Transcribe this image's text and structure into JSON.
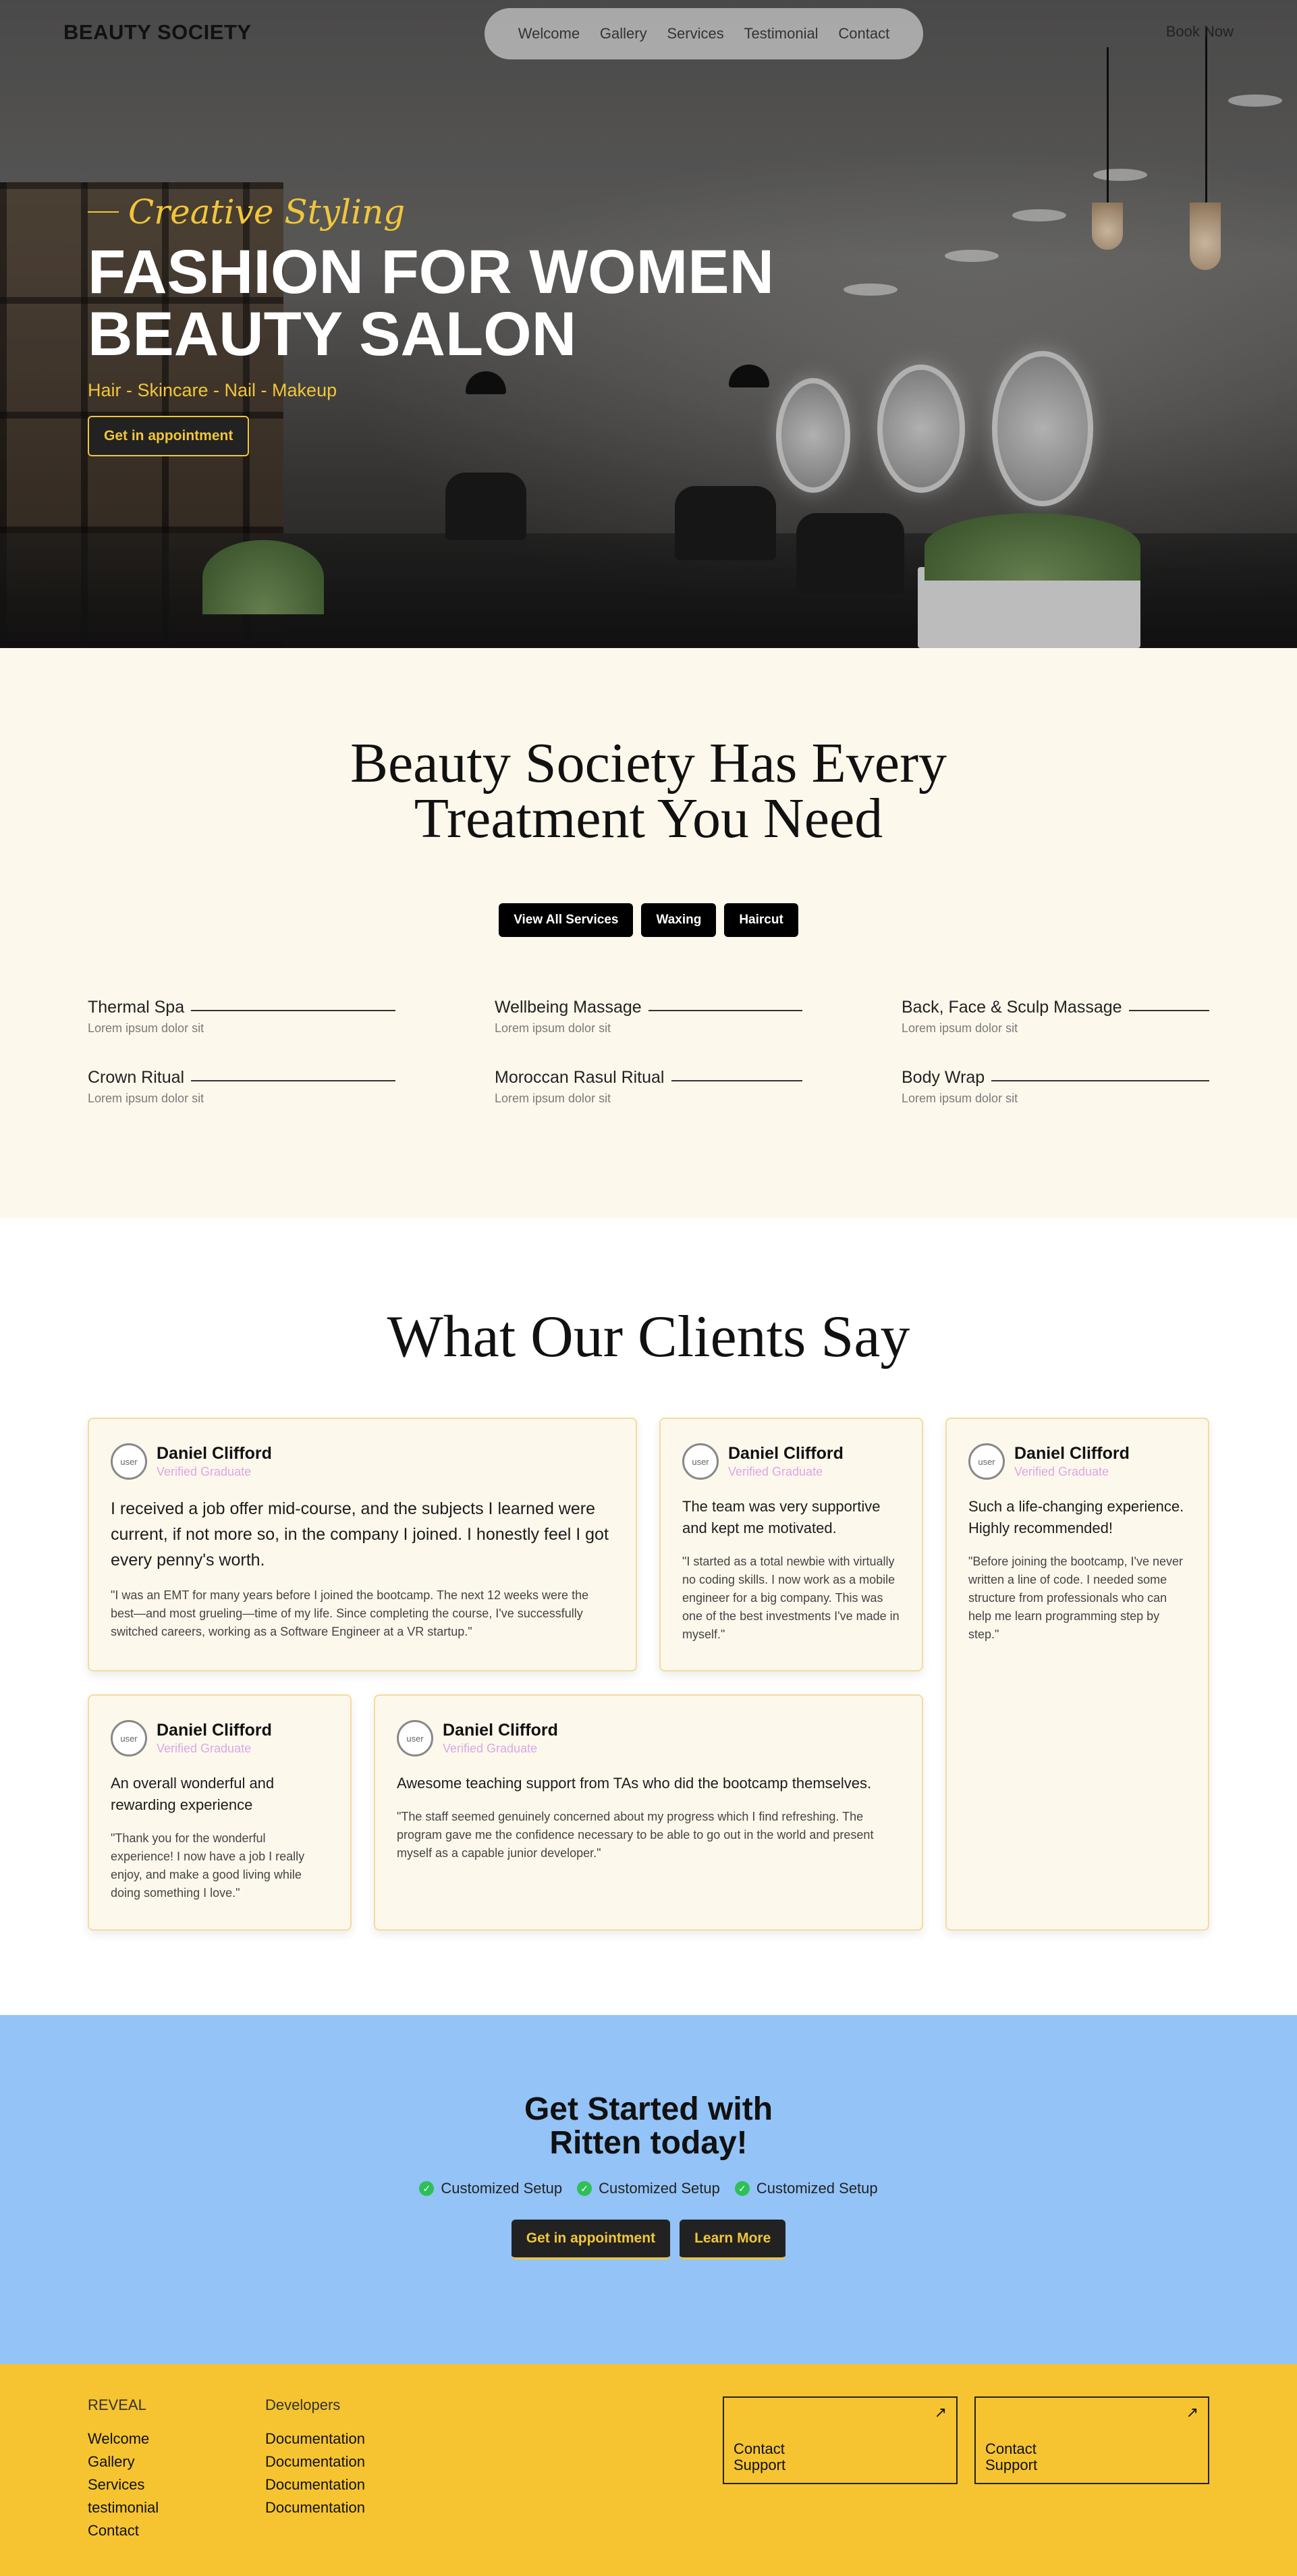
{
  "nav": {
    "logo": "BEAUTY SOCIETY",
    "links": [
      "Welcome",
      "Gallery",
      "Services",
      "Testimonial",
      "Contact"
    ],
    "cta": "Book Now"
  },
  "hero": {
    "tagline": "Creative Styling",
    "title_line1": "FASHION FOR WOMEN",
    "title_line2": "BEAUTY SALON",
    "subtitle": "Hair - Skincare - Nail - Makeup",
    "button": "Get in appointment"
  },
  "services": {
    "heading_line1": "Beauty Society Has Every",
    "heading_line2": "Treatment You Need",
    "tabs": [
      "View All Services",
      "Waxing",
      "Haircut"
    ],
    "items": [
      {
        "name": "Thermal Spa",
        "desc": "Lorem ipsum dolor sit"
      },
      {
        "name": "Wellbeing Massage",
        "desc": "Lorem ipsum dolor sit"
      },
      {
        "name": "Back, Face & Sculp Massage",
        "desc": "Lorem ipsum dolor sit"
      },
      {
        "name": "Crown Ritual",
        "desc": "Lorem ipsum dolor sit"
      },
      {
        "name": "Moroccan Rasul Ritual",
        "desc": "Lorem ipsum dolor sit"
      },
      {
        "name": "Body Wrap",
        "desc": "Lorem ipsum dolor sit"
      }
    ]
  },
  "testimonials": {
    "heading": "What Our Clients Say",
    "avatar_alt": "user",
    "cards": [
      {
        "name": "Daniel Clifford",
        "role": "Verified Graduate",
        "quote": "I received a job offer mid-course, and the subjects I learned were current, if not more so, in the company I joined. I honestly feel I got every penny's worth.",
        "text": "\"I was an EMT for many years before I joined the bootcamp. The next 12 weeks were the best—and most grueling—time of my life. Since completing the course, I've successfully switched careers, working as a Software Engineer at a VR startup.\""
      },
      {
        "name": "Daniel Clifford",
        "role": "Verified Graduate",
        "quote": "The team was very supportive and kept me motivated.",
        "text": "\"I started as a total newbie with virtually no coding skills. I now work as a mobile engineer for a big company. This was one of the best investments I've made in myself.\""
      },
      {
        "name": "Daniel Clifford",
        "role": "Verified Graduate",
        "quote": "Such a life-changing experience. Highly recommended!",
        "text": "\"Before joining the bootcamp, I've never written a line of code. I needed some structure from professionals who can help me learn programming step by step.\""
      },
      {
        "name": "Daniel Clifford",
        "role": "Verified Graduate",
        "quote": "An overall wonderful and rewarding experience",
        "text": "\"Thank you for the wonderful experience! I now have a job I really enjoy, and make a good living while doing something I love.\""
      },
      {
        "name": "Daniel Clifford",
        "role": "Verified Graduate",
        "quote": "Awesome teaching support from TAs who did the bootcamp themselves.",
        "text": "\"The staff seemed genuinely concerned about my progress which I find refreshing. The program gave me the confidence necessary to be able to go out in the world and present myself as a capable junior developer.\""
      }
    ]
  },
  "cta": {
    "heading_line1": "Get Started with",
    "heading_line2": "Ritten today!",
    "features": [
      "Customized Setup",
      "Customized Setup",
      "Customized Setup"
    ],
    "primary_button": "Get in appointment",
    "secondary_button": "Learn More"
  },
  "footer": {
    "col1_head": "REVEAL",
    "col1_links": [
      "Welcome",
      "Gallery",
      "Services",
      "testimonial",
      "Contact"
    ],
    "col2_head": "Developers",
    "col2_links": [
      "Documentation",
      "Documentation",
      "Documentation",
      "Documentation"
    ],
    "boxes": [
      {
        "line1": "Contact",
        "line2": "Support"
      },
      {
        "line1": "Contact",
        "line2": "Support"
      }
    ]
  },
  "colors": {
    "accent_yellow": "#f1c63a",
    "cream": "#fdf8ec",
    "cta_blue": "#93c3f7",
    "footer_yellow": "#f5c430"
  }
}
